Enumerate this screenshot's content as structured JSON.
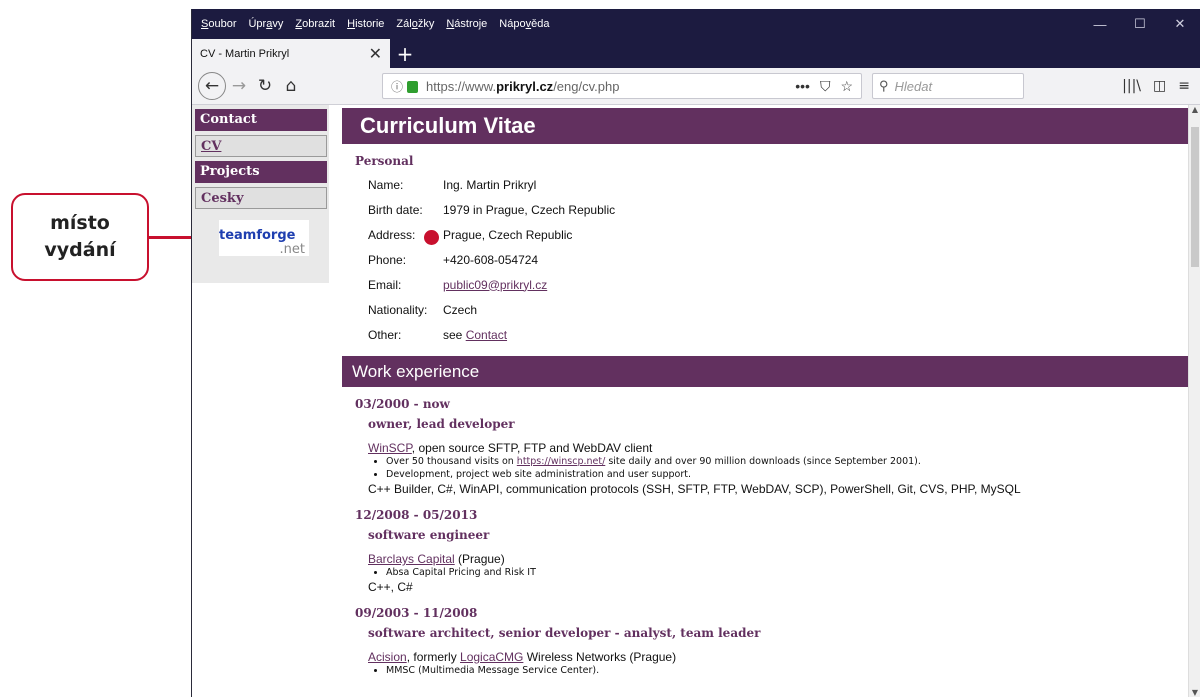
{
  "callout": {
    "line1": "místo",
    "line2": "vydání",
    "color": "#c8102e"
  },
  "menubar": {
    "items": [
      {
        "pre": "",
        "u": "S",
        "post": "oubor"
      },
      {
        "pre": "Úpr",
        "u": "a",
        "post": "vy"
      },
      {
        "pre": "",
        "u": "Z",
        "post": "obrazit"
      },
      {
        "pre": "",
        "u": "H",
        "post": "istorie"
      },
      {
        "pre": "Zál",
        "u": "o",
        "post": "žky"
      },
      {
        "pre": "",
        "u": "N",
        "post": "ástroje"
      },
      {
        "pre": "Nápo",
        "u": "v",
        "post": "ěda"
      }
    ],
    "minimize": "—",
    "maximize": "☐",
    "close": "✕"
  },
  "tab": {
    "title": "CV - Martin Prikryl",
    "close": "✕",
    "new": "+"
  },
  "navbar": {
    "back": "←",
    "forward": "→",
    "reload": "↻",
    "home": "⌂",
    "url_prefix": "https://www.",
    "url_host": "prikryl.cz",
    "url_path": "/eng/cv.php",
    "page_actions": "•••",
    "pocket": "⛉",
    "bookmark": "☆",
    "search_placeholder": "Hledat",
    "library": "|||\\",
    "sidebar": "◫",
    "menu": "≡"
  },
  "leftnav": {
    "items": [
      {
        "label": "Contact",
        "style": "dark"
      },
      {
        "label": "CV",
        "style": "light cv"
      },
      {
        "label": "Projects",
        "style": "dark"
      },
      {
        "label": "Cesky",
        "style": "light"
      }
    ],
    "logo_line1": "teamforge",
    "logo_line2": ".net"
  },
  "content": {
    "title": "Curriculum Vitae",
    "personal_heading": "Personal",
    "personal": [
      {
        "key": "Name:",
        "value": "Ing. Martin Prikryl"
      },
      {
        "key": "Birth date:",
        "value": "1979 in Prague, Czech Republic"
      },
      {
        "key": "Address:",
        "value": "Prague, Czech Republic"
      },
      {
        "key": "Phone:",
        "value": "+420-608-054724"
      },
      {
        "key": "Email:",
        "value": "public09@prikryl.cz",
        "link": true
      },
      {
        "key": "Nationality:",
        "value": "Czech"
      },
      {
        "key": "Other:",
        "value_prefix": "see ",
        "value": "Contact",
        "link": true
      }
    ],
    "work_heading": "Work experience",
    "jobs": [
      {
        "date": "03/2000 - now",
        "role": "owner, lead developer",
        "company_link": "WinSCP",
        "company_rest": ", open source SFTP, FTP and WebDAV client",
        "bullets": [
          {
            "pre": "Over 50 thousand visits on ",
            "link": "https://winscp.net/",
            "post": " site daily and over 90 million downloads (since September 2001)."
          },
          {
            "pre": "Development, project web site administration and user support.",
            "link": "",
            "post": ""
          }
        ],
        "tech": "C++ Builder, C#, WinAPI, communication protocols (SSH, SFTP, FTP, WebDAV, SCP), PowerShell, Git, CVS, PHP, MySQL"
      },
      {
        "date": "12/2008 - 05/2013",
        "role": "software engineer",
        "company_link": "Barclays Capital",
        "company_rest": " (Prague)",
        "bullets": [
          {
            "pre": "Absa Capital Pricing and Risk IT",
            "link": "",
            "post": ""
          }
        ],
        "tech": "C++, C#"
      },
      {
        "date": "09/2003 - 11/2008",
        "role": "software architect, senior developer - analyst, team leader",
        "company_link": "Acision",
        "company_mid": ", formerly ",
        "company_link2": "LogicaCMG",
        "company_rest": " Wireless Networks (Prague)",
        "bullets": [
          {
            "pre": "MMSC (Multimedia Message Service Center).",
            "link": "",
            "post": ""
          }
        ],
        "tech": ""
      }
    ]
  },
  "colors": {
    "accent": "#62305f",
    "menubar": "#1c1b40",
    "callout": "#c8102e"
  }
}
